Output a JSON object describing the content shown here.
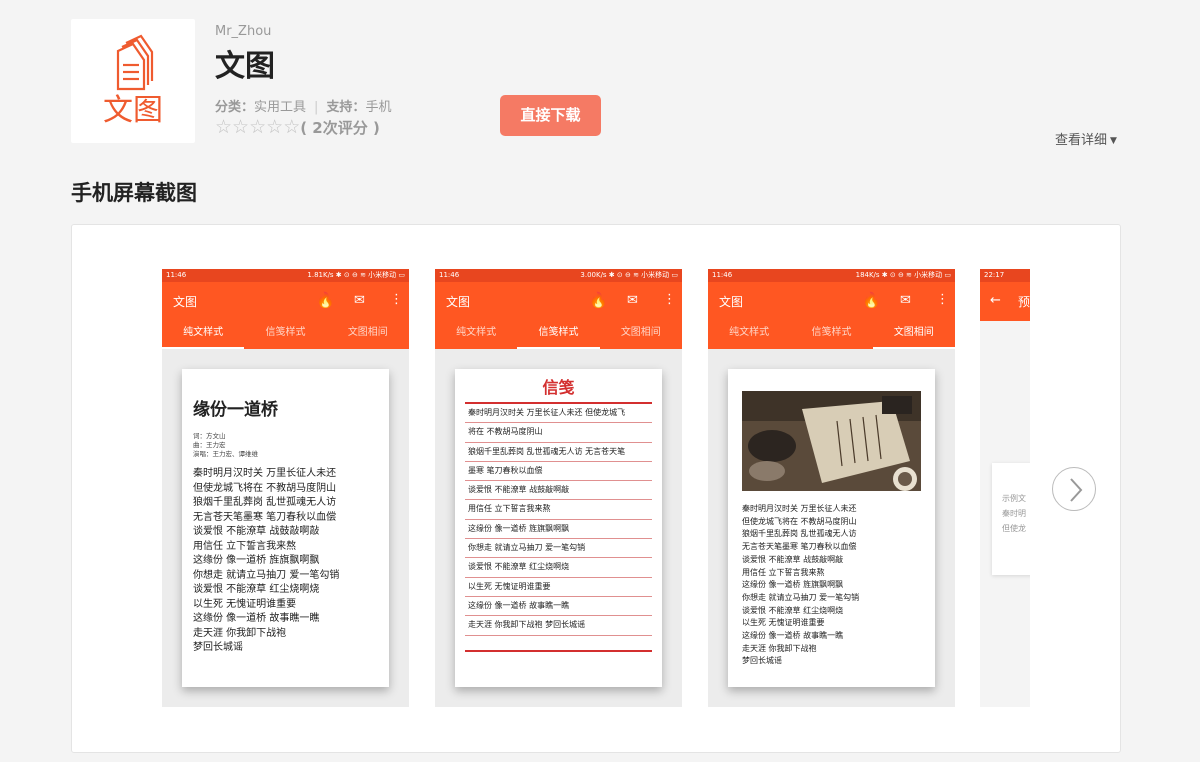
{
  "app": {
    "developer": "Mr_Zhou",
    "name": "文图",
    "icon_text": "文图",
    "category_label": "分类：",
    "category": "实用工具",
    "support_label": "支持：",
    "support": "手机",
    "rating_count": "( 2次评分 )",
    "download_label": "直接下载",
    "details_label": "查看详细",
    "accent_color": "#ff5722",
    "download_color": "#f57a64"
  },
  "section": {
    "title": "手机屏幕截图"
  },
  "screenshots": [
    {
      "status_time": "11:46",
      "status_right": "1.81K/s ✱ ⊙ ⊖ ≋ 小米移动 ▭",
      "app_title": "文图",
      "tabs": [
        "纯文样式",
        "信笺样式",
        "文图相间"
      ],
      "active_tab": 0,
      "title": "缘份一道桥",
      "credits": [
        "词：方文山",
        "曲：王力宏",
        "演唱：王力宏、谭维维"
      ],
      "lyrics": [
        "秦时明月汉时关 万里长征人未还",
        "但使龙城飞将在 不教胡马度阴山",
        "狼烟千里乱葬岗 乱世孤魂无人访",
        "无言苍天笔墨寒 笔刀春秋以血偿",
        "谈爱恨 不能潦草 战鼓敲啊敲",
        "用信任 立下誓言我来熬",
        "这缘份 像一道桥 旌旗飘啊飘",
        "你想走 就请立马抽刀 爱一笔勾销",
        "谈爱恨 不能潦草 红尘烧啊烧",
        "以生死 无愧证明谁重要",
        "这缘份 像一道桥 故事瞧一瞧",
        "走天涯 你我卸下战袍",
        "梦回长城谣"
      ]
    },
    {
      "status_time": "11:46",
      "status_right": "3.00K/s ✱ ⊙ ⊖ ≋ 小米移动 ▭",
      "app_title": "文图",
      "tabs": [
        "纯文样式",
        "信笺样式",
        "文图相间"
      ],
      "active_tab": 1,
      "letter_title": "信笺",
      "lines": [
        "秦时明月汉时关 万里长征人未还 但使龙城飞",
        "将在 不教胡马度阴山",
        "狼烟千里乱葬岗 乱世孤魂无人访 无言苍天笔",
        "墨寒 笔刀春秋以血偿",
        "谈爱恨 不能潦草 战鼓敲啊敲",
        "用信任 立下誓言我来熬",
        "这缘份 像一道桥 旌旗飘啊飘",
        "你想走 就请立马抽刀 爱一笔勾销",
        "谈爱恨 不能潦草 红尘烧啊烧",
        "以生死 无愧证明谁重要",
        "这缘份 像一道桥 故事瞧一瞧",
        "走天涯 你我卸下战袍 梦回长城谣"
      ]
    },
    {
      "status_time": "11:46",
      "status_right": "184K/s ✱ ⊙ ⊖ ≋ 小米移动 ▭",
      "app_title": "文图",
      "tabs": [
        "纯文样式",
        "信笺样式",
        "文图相间"
      ],
      "active_tab": 2,
      "lyrics": [
        "秦时明月汉时关 万里长征人未还",
        "但使龙城飞将在 不教胡马度阴山",
        "狼烟千里乱葬岗 乱世孤魂无人访",
        "无言苍天笔墨寒 笔刀春秋以血偿",
        "谈爱恨 不能潦草 战鼓敲啊敲",
        "用信任 立下誓言我来熬",
        "这缘份 像一道桥 旌旗飘啊飘",
        "你想走 就请立马抽刀 爱一笔勾销",
        "谈爱恨 不能潦草 红尘烧啊烧",
        "以生死 无愧证明谁重要",
        "这缘份 像一道桥 故事瞧一瞧",
        "走天涯 你我卸下战袍",
        "梦回长城谣"
      ]
    },
    {
      "status_time": "22:17",
      "back_icon": "arrow-left-icon",
      "app_title_partial": "预",
      "partial_lines": [
        "示例文",
        "秦时明",
        "但使龙"
      ]
    }
  ]
}
